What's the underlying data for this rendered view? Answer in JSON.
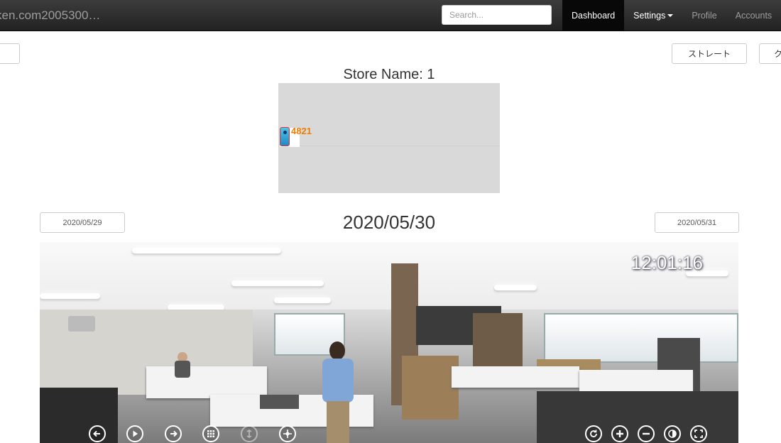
{
  "navbar": {
    "brand": "ken.com2005300…",
    "search_placeholder": "Search...",
    "items": [
      {
        "label": "Dashboard",
        "active": true
      },
      {
        "label": "Settings",
        "dropdown": true
      },
      {
        "label": "Profile"
      },
      {
        "label": "Accounts"
      }
    ]
  },
  "toolbar": {
    "left_button_label": "",
    "straight_button_label": "ストレート",
    "right_button_label": "ク"
  },
  "store": {
    "title": "Store Name: 1",
    "camera_label": "4821"
  },
  "date_nav": {
    "prev": "2020/05/29",
    "current": "2020/05/30",
    "next": "2020/05/31"
  },
  "viewer": {
    "timestamp": "12:01:16",
    "controls_left": [
      "prev-icon",
      "play-icon",
      "next-icon",
      "grid-icon",
      "sync-icon",
      "crosshair-icon"
    ],
    "controls_right": [
      "rotate-icon",
      "zoom-in-icon",
      "zoom-out-icon",
      "contrast-icon",
      "fullscreen-icon"
    ]
  },
  "colors": {
    "navbar_bg": "#222222",
    "active_nav": "#080808",
    "camera_label": "#f07c00",
    "map_bg": "#d9d9d9"
  }
}
